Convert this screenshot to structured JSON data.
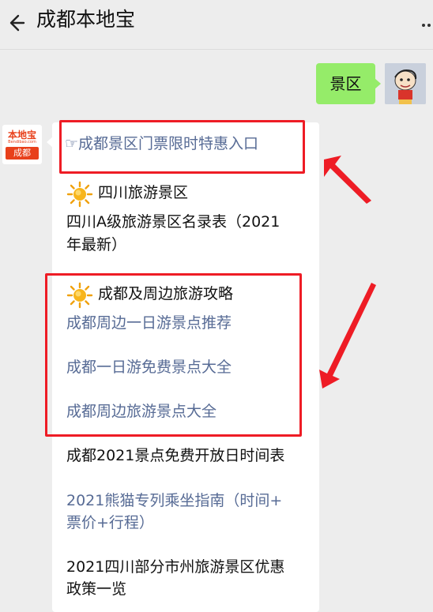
{
  "header": {
    "title": "成都本地宝"
  },
  "outgoing": {
    "text": "景区"
  },
  "bot": {
    "logo_text": "本地宝",
    "logo_sub": "Bendibao.com",
    "logo_city": "成都"
  },
  "message": {
    "entry_link": "☞成都景区门票限时特惠入口",
    "section1_title": "四川旅游景区",
    "section1_text_line1": "四川A级旅游景区名录表（2021",
    "section1_text_line2": "年最新）",
    "section2_title": "成都及周边旅游攻略",
    "links": [
      "成都周边一日游景点推荐",
      "成都一日游免费景点大全",
      "成都周边旅游景点大全"
    ],
    "item_open_days": "成都2021景点免费开放日时间表",
    "panda_line1": "2021熊猫专列乘坐指南（时间+",
    "panda_line2": "票价+行程）",
    "offer_line1": "2021四川部分市州旅游景区优惠",
    "offer_line2": "政策一览"
  },
  "colors": {
    "annotation_red": "#ee1c25",
    "link_blue": "#576b95",
    "bubble_green": "#95ec69"
  },
  "icons": [
    "back-arrow-icon",
    "more-icon",
    "sun-icon",
    "arrow-annotation"
  ]
}
